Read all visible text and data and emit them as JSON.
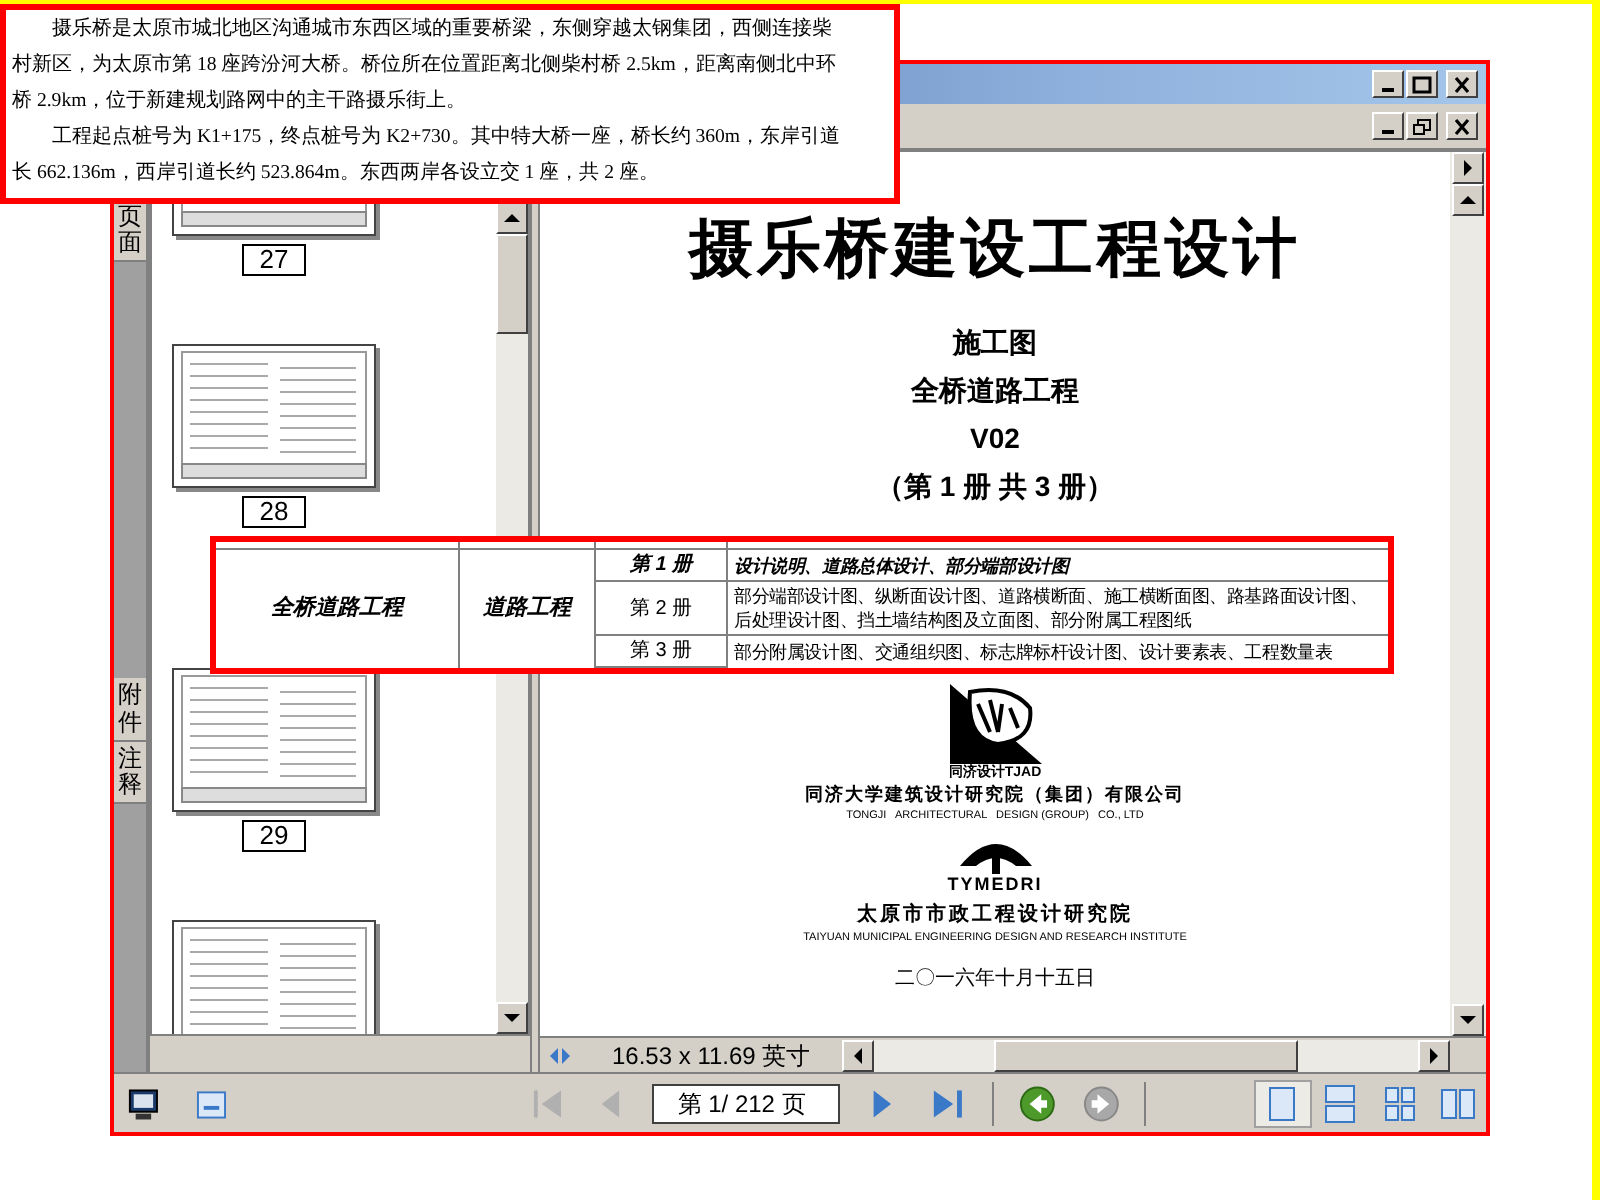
{
  "excerpt": {
    "lines": [
      {
        "text": "摄乐桥是太原市城北地区沟通城市东西区域的重要桥梁，东侧穿越太钢集团，西侧连接柴",
        "indent": true
      },
      {
        "text": "村新区，为太原市第 18 座跨汾河大桥。桥位所在位置距离北侧柴村桥 2.5km，距离南侧北中环",
        "indent": false
      },
      {
        "text": "桥 2.9km，位于新建规划路网中的主干路摄乐街上。",
        "indent": false
      },
      {
        "text": "工程起点桩号为 K1+175，终点桩号为 K2+730。其中特大桥一座，桥长约 360m，东岸引道",
        "indent": true
      },
      {
        "text": "长 662.136m，西岸引道长约 523.864m。东西两岸各设立交 1 座，共 2 座。",
        "indent": false
      }
    ]
  },
  "sidebar": {
    "tabs": [
      {
        "label": "页面"
      },
      {
        "label": "附件"
      },
      {
        "label": "注释"
      }
    ],
    "thumbnails": [
      {
        "label": "27"
      },
      {
        "label": "28"
      },
      {
        "label": "29"
      }
    ]
  },
  "document": {
    "title": "摄乐桥建设工程设计",
    "subtitles": [
      "施工图",
      "全桥道路工程",
      "V02",
      "（第 1 册 共 3 册）"
    ],
    "org1": {
      "logo_caption": "同济设计TJAD",
      "name": "同济大学建筑设计研究院（集团）有限公司",
      "english": "TONGJI   ARCHITECTURAL   DESIGN (GROUP)   CO., LTD"
    },
    "org2": {
      "logo_text": "TYMEDRI",
      "name": "太原市市政工程设计研究院",
      "english": "TAIYUAN MUNICIPAL ENGINEERING DESIGN AND RESEARCH INSTITUTE"
    },
    "date": "二〇一六年十月十五日"
  },
  "status_bar": {
    "page_size": "16.53 x 11.69 英寸"
  },
  "toolbar": {
    "page_field": "第 1/ 212 页",
    "nav": [
      {
        "kind": "first",
        "disabled": true
      },
      {
        "kind": "prev",
        "disabled": true
      },
      {
        "kind": "next",
        "disabled": false
      },
      {
        "kind": "last",
        "disabled": false
      }
    ],
    "history": [
      {
        "kind": "back",
        "disabled": false
      },
      {
        "kind": "forward",
        "disabled": true
      }
    ],
    "views": [
      {
        "kind": "single",
        "selected": true
      },
      {
        "kind": "continuous",
        "selected": false
      },
      {
        "kind": "grid",
        "selected": false
      },
      {
        "kind": "facing",
        "selected": false
      }
    ]
  },
  "table_excerpt": {
    "project": "全桥道路工程",
    "discipline": "道路工程",
    "rows": [
      {
        "volume": "第 1 册",
        "content": "设计说明、道路总体设计、部分端部设计图",
        "emphasis": true
      },
      {
        "volume": "第 2 册",
        "content": "部分端部设计图、纵断面设计图、道路横断面、施工横断面图、路基路面设计图、后处理设计图、挡土墙结构图及立面图、部分附属工程图纸",
        "emphasis": false
      },
      {
        "volume": "第 3 册",
        "content": "部分附属设计图、交通组织图、标志牌标杆设计图、设计要素表、工程数量表",
        "emphasis": false
      }
    ]
  }
}
